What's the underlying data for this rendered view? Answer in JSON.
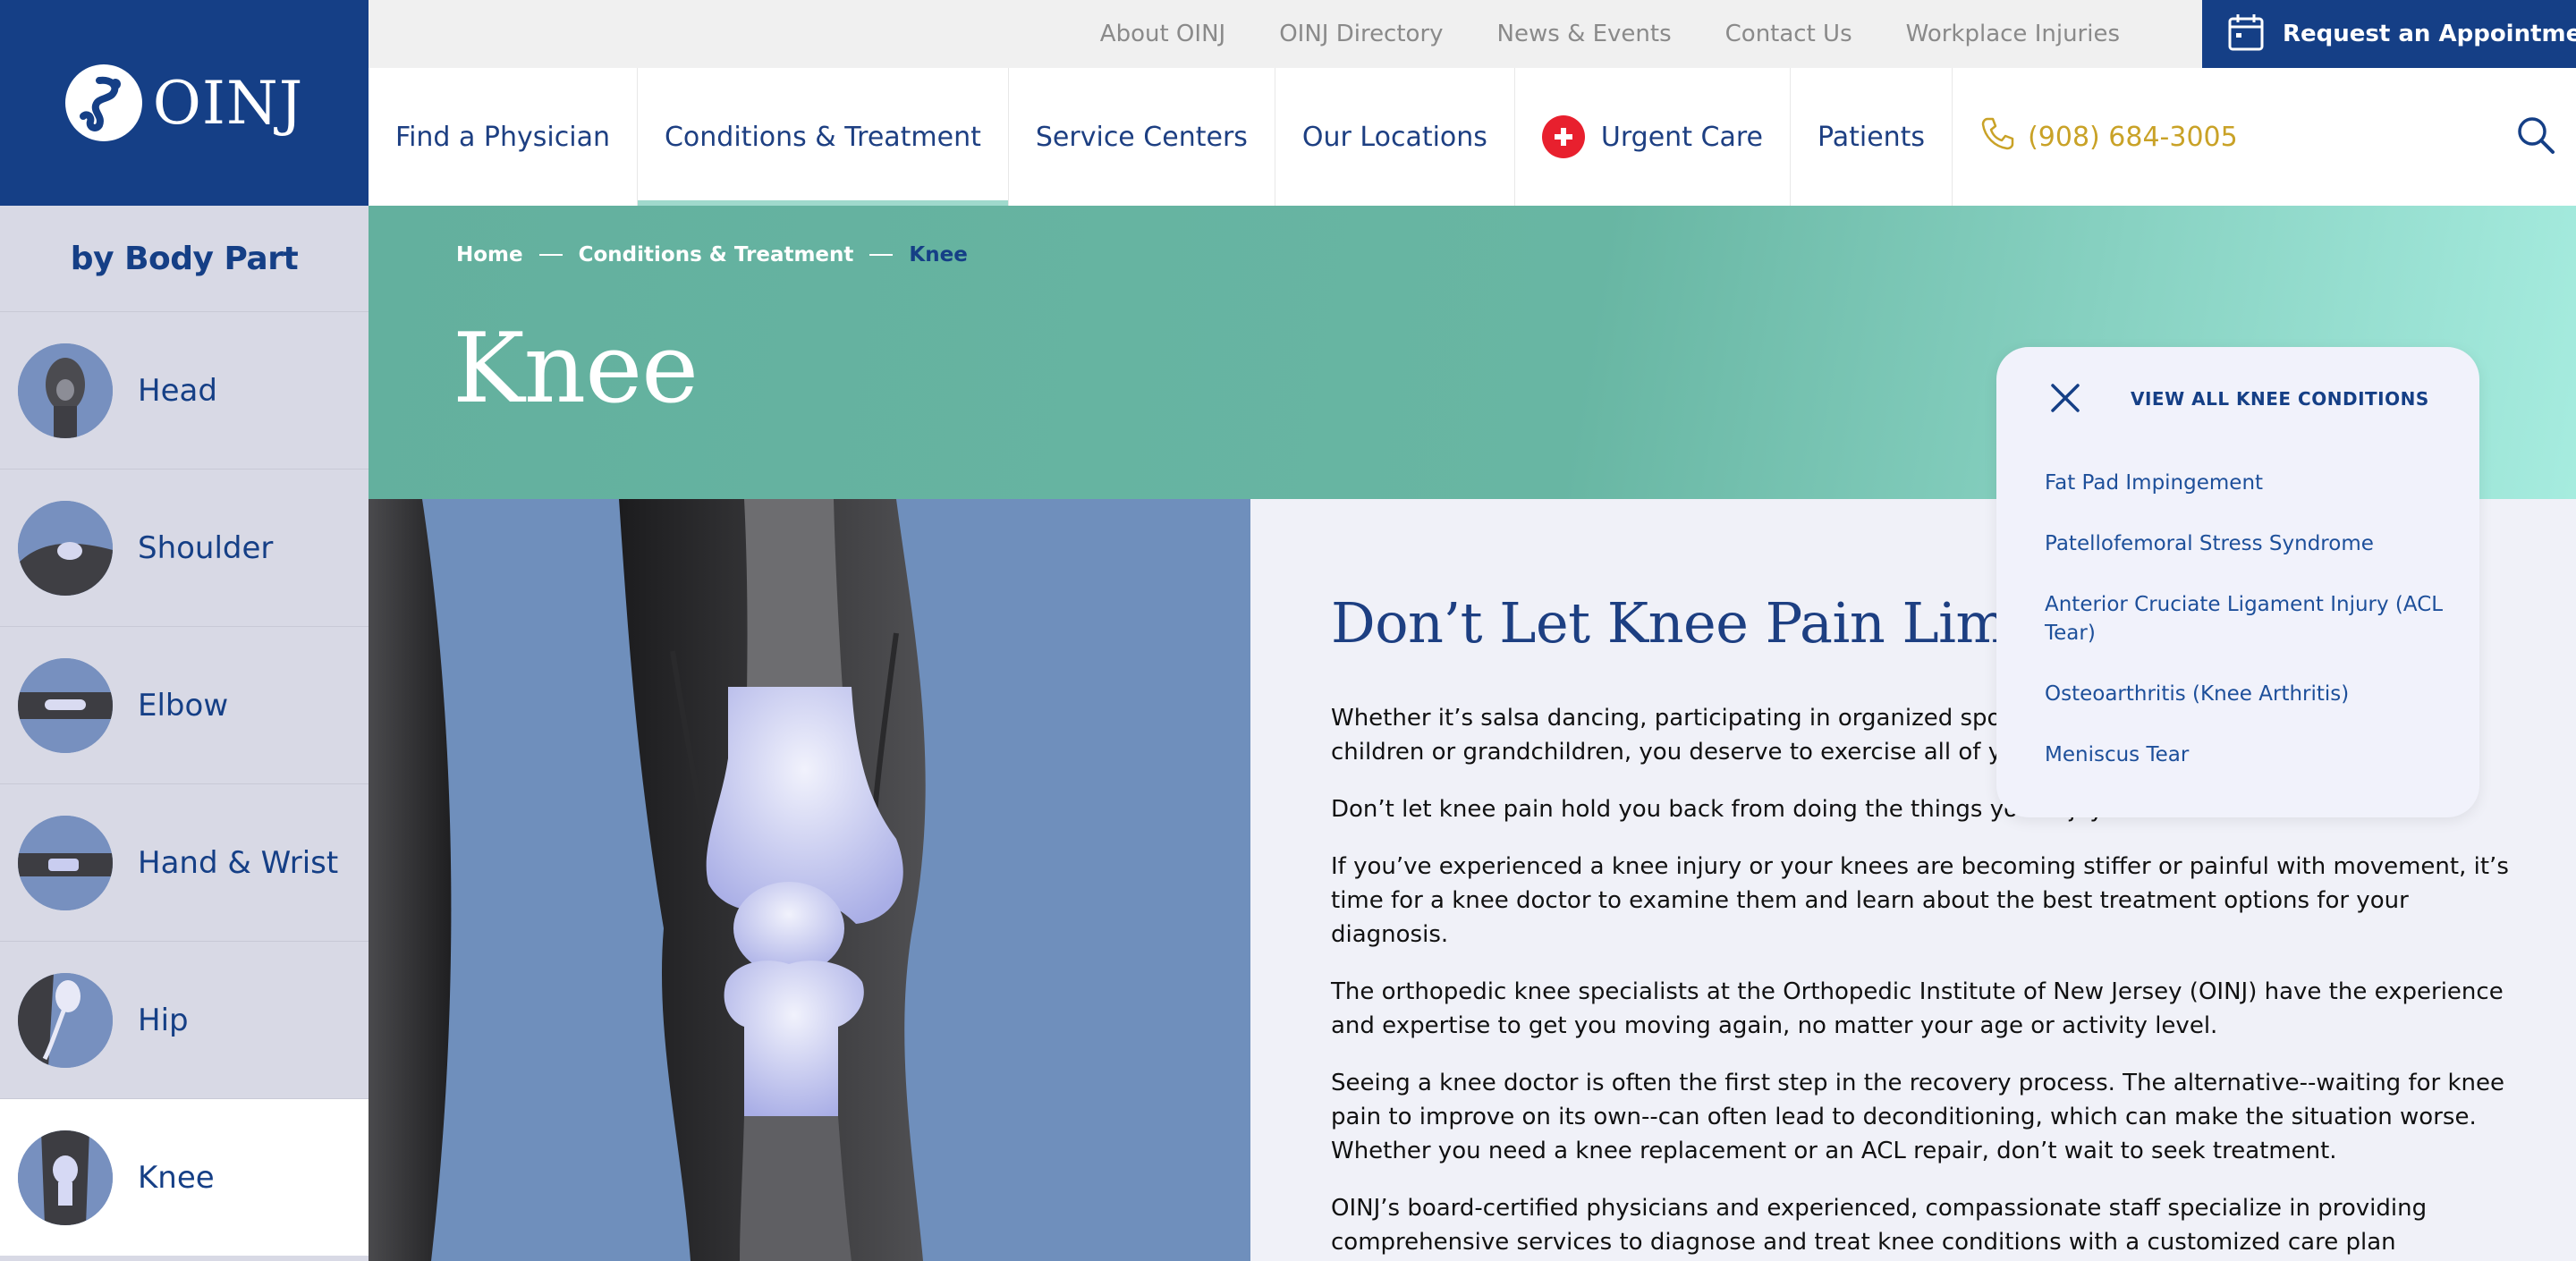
{
  "brand": {
    "name": "OINJ"
  },
  "utility": {
    "links": [
      "About OINJ",
      "OINJ Directory",
      "News & Events",
      "Contact Us",
      "Workplace Injuries"
    ],
    "appointment_label": "Request an Appointment"
  },
  "nav": {
    "items": [
      "Find a Physician",
      "Conditions & Treatment",
      "Service Centers",
      "Our Locations",
      "Urgent Care",
      "Patients"
    ],
    "active_item": "Conditions & Treatment",
    "phone": "(908) 684-3005"
  },
  "sidebar": {
    "title": "by Body Part",
    "items": [
      "Head",
      "Shoulder",
      "Elbow",
      "Hand & Wrist",
      "Hip",
      "Knee"
    ],
    "active_item": "Knee"
  },
  "breadcrumb": [
    "Home",
    "Conditions & Treatment",
    "Knee"
  ],
  "page": {
    "title": "Knee"
  },
  "content": {
    "heading": "Don’t Let Knee Pain Limit You",
    "paragraphs": [
      "Whether it’s salsa dancing, participating in organized sports, walking the dog or playing with your children or grandchildren, you deserve to exercise all of your options!",
      "Don’t let knee pain hold you back from doing the things you enjoy.",
      "If you’ve experienced a knee injury or your knees are becoming stiffer or painful with movement, it’s time for a knee doctor to examine them and learn about the best treatment options for your diagnosis.",
      "The orthopedic knee specialists at the Orthopedic Institute of New Jersey (OINJ) have the experience and expertise to get you moving again, no matter your age or activity level.",
      "Seeing a knee doctor is often the first step in the recovery process. The alternative--waiting for knee pain to improve on its own--can often lead to deconditioning, which can make the situation worse. Whether you need a knee replacement or an ACL repair, don’t wait to seek treatment.",
      "OINJ’s board-certified physicians and experienced, compassionate staff specialize in providing comprehensive services to diagnose and treat knee conditions with a customized care plan specifically designed for you."
    ]
  },
  "conditions_panel": {
    "title": "VIEW ALL KNEE CONDITIONS",
    "items": [
      "Fat Pad Impingement",
      "Patellofemoral Stress Syndrome",
      "Anterior Cruciate Ligament Injury (ACL Tear)",
      "Osteoarthritis (Knee Arthritis)",
      "Meniscus Tear"
    ]
  },
  "colors": {
    "brand_navy": "#153f86",
    "hero_teal": "#67b3a1",
    "phone_gold": "#c9a227",
    "urgent_red": "#e8202e"
  },
  "icons": [
    "calendar-icon",
    "plus-icon",
    "phone-icon",
    "search-icon",
    "close-icon"
  ]
}
